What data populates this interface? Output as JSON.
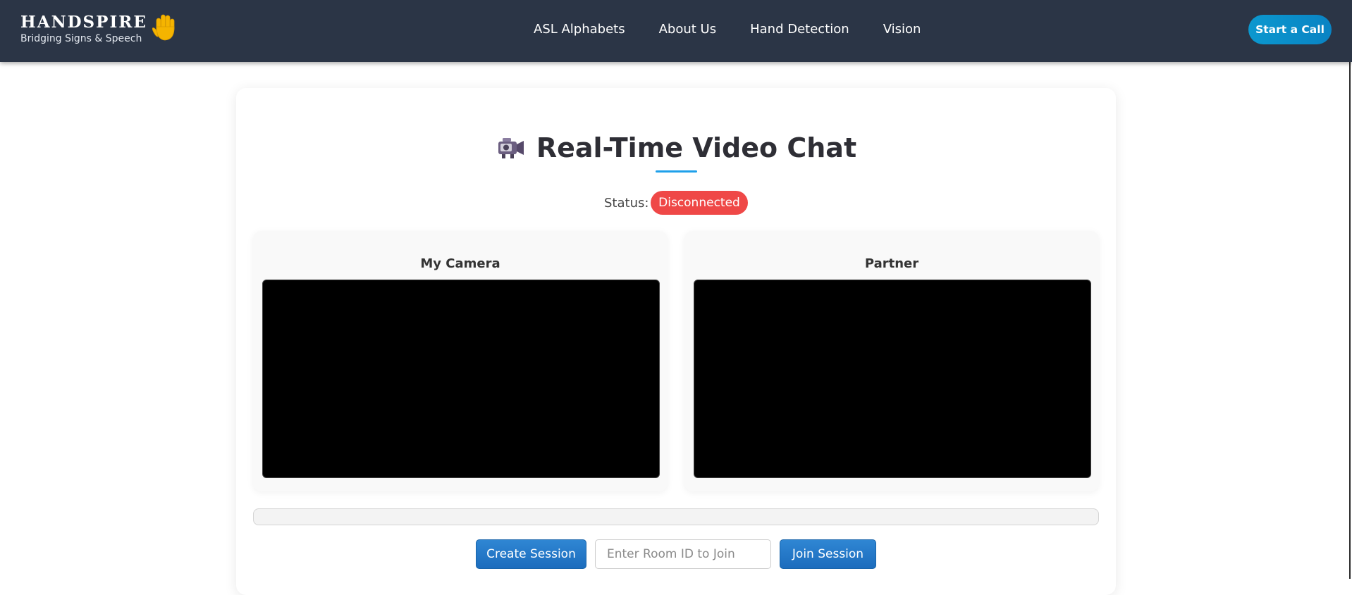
{
  "header": {
    "brand_name": "HANDSPIRE",
    "brand_tagline": "Bridging Signs & Speech",
    "brand_icon": "raised-hand-icon",
    "nav": [
      {
        "label": "ASL Alphabets"
      },
      {
        "label": "About Us"
      },
      {
        "label": "Hand Detection"
      },
      {
        "label": "Vision"
      }
    ],
    "cta_label": "Start a Call"
  },
  "main": {
    "title_icon": "video-camera-icon",
    "title": "Real-Time Video Chat",
    "status_label": "Status:",
    "status_value": "Disconnected",
    "panels": [
      {
        "title": "My Camera"
      },
      {
        "title": "Partner"
      }
    ],
    "controls": {
      "create_label": "Create Session",
      "room_placeholder": "Enter Room ID to Join",
      "room_value": "",
      "join_label": "Join Session"
    }
  },
  "colors": {
    "navbar_bg": "#2b3546",
    "accent": "#1fa0ea",
    "status_disconnected": "#ef4847",
    "button_blue": "#1c6cbd",
    "cta": "#0a8fcb"
  }
}
